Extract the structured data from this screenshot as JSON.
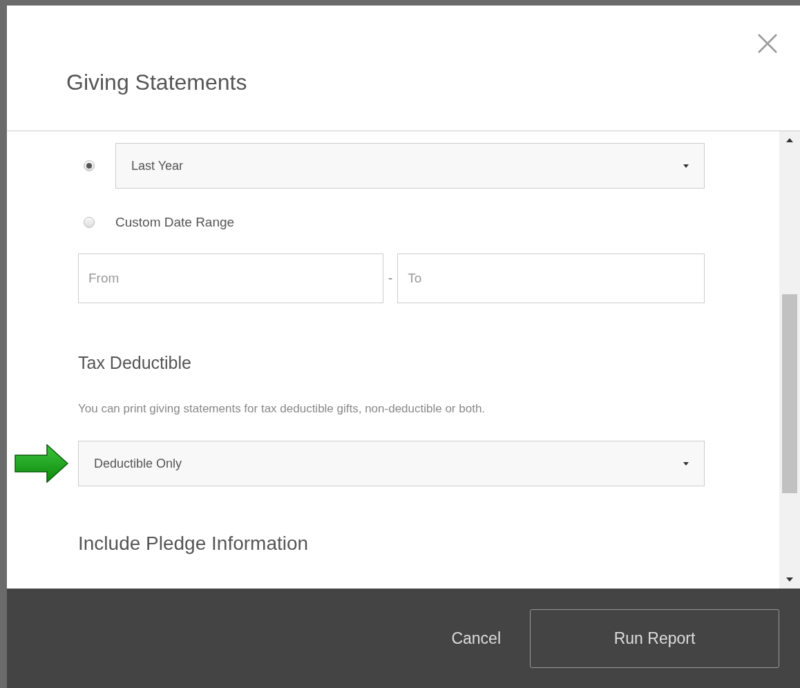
{
  "dialog": {
    "title": "Giving Statements"
  },
  "date_options": [
    {
      "kind": "select",
      "selected": true,
      "value": "Last Year"
    },
    {
      "kind": "label",
      "selected": false,
      "label": "Custom Date Range"
    }
  ],
  "date_range": {
    "from_placeholder": "From",
    "separator": "-",
    "to_placeholder": "To"
  },
  "tax_section": {
    "heading": "Tax Deductible",
    "description": "You can print giving statements for tax deductible gifts, non-deductible or both.",
    "select_value": "Deductible Only"
  },
  "pledge_section": {
    "heading": "Include Pledge Information"
  },
  "buttons": [
    {
      "kind": "link",
      "label": "Cancel"
    },
    {
      "kind": "outline",
      "label": "Run Report"
    }
  ]
}
